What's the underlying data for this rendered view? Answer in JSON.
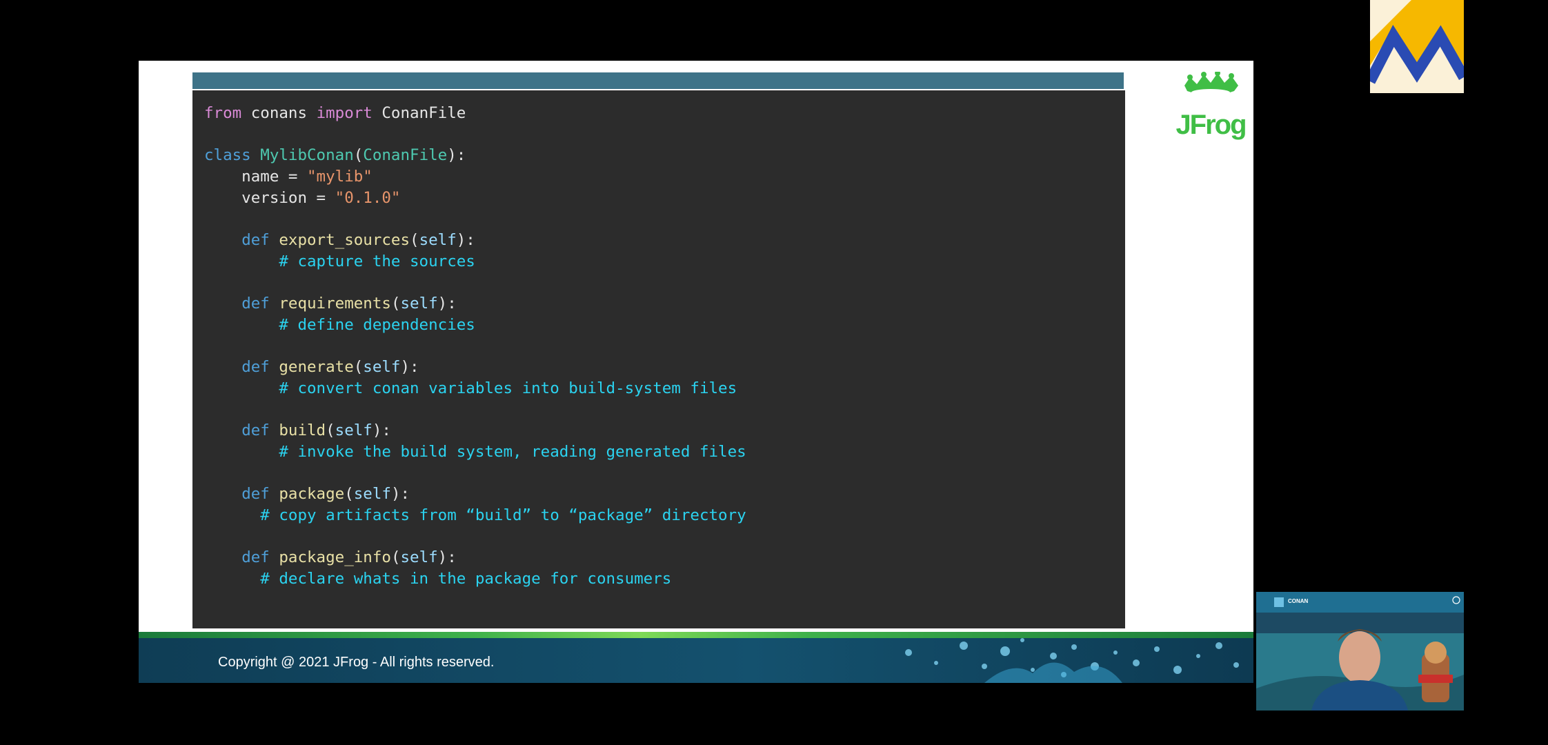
{
  "code": {
    "lines": [
      [
        {
          "t": "from",
          "c": "kw-pink"
        },
        {
          "t": " conans ",
          "c": ""
        },
        {
          "t": "import",
          "c": "kw-pink"
        },
        {
          "t": " ConanFile",
          "c": ""
        }
      ],
      [],
      [
        {
          "t": "class",
          "c": "kw-blue"
        },
        {
          "t": " ",
          "c": ""
        },
        {
          "t": "MylibConan",
          "c": "cls"
        },
        {
          "t": "(",
          "c": ""
        },
        {
          "t": "ConanFile",
          "c": "cls"
        },
        {
          "t": "):",
          "c": ""
        }
      ],
      [
        {
          "t": "    name = ",
          "c": ""
        },
        {
          "t": "\"mylib\"",
          "c": "str"
        }
      ],
      [
        {
          "t": "    version = ",
          "c": ""
        },
        {
          "t": "\"0.1.0\"",
          "c": "str"
        }
      ],
      [],
      [
        {
          "t": "    ",
          "c": ""
        },
        {
          "t": "def",
          "c": "kw-blue"
        },
        {
          "t": " ",
          "c": ""
        },
        {
          "t": "export_sources",
          "c": "fn"
        },
        {
          "t": "(",
          "c": ""
        },
        {
          "t": "self",
          "c": "self"
        },
        {
          "t": "):",
          "c": ""
        }
      ],
      [
        {
          "t": "        # capture the sources",
          "c": "cmt"
        }
      ],
      [],
      [
        {
          "t": "    ",
          "c": ""
        },
        {
          "t": "def",
          "c": "kw-blue"
        },
        {
          "t": " ",
          "c": ""
        },
        {
          "t": "requirements",
          "c": "fn"
        },
        {
          "t": "(",
          "c": ""
        },
        {
          "t": "self",
          "c": "self"
        },
        {
          "t": "):",
          "c": ""
        }
      ],
      [
        {
          "t": "        # define dependencies",
          "c": "cmt"
        }
      ],
      [],
      [
        {
          "t": "    ",
          "c": ""
        },
        {
          "t": "def",
          "c": "kw-blue"
        },
        {
          "t": " ",
          "c": ""
        },
        {
          "t": "generate",
          "c": "fn"
        },
        {
          "t": "(",
          "c": ""
        },
        {
          "t": "self",
          "c": "self"
        },
        {
          "t": "):",
          "c": ""
        }
      ],
      [
        {
          "t": "        # convert conan variables into build-system files",
          "c": "cmt"
        }
      ],
      [],
      [
        {
          "t": "    ",
          "c": ""
        },
        {
          "t": "def",
          "c": "kw-blue"
        },
        {
          "t": " ",
          "c": ""
        },
        {
          "t": "build",
          "c": "fn"
        },
        {
          "t": "(",
          "c": ""
        },
        {
          "t": "self",
          "c": "self"
        },
        {
          "t": "):",
          "c": ""
        }
      ],
      [
        {
          "t": "        # invoke the build system, reading generated files",
          "c": "cmt"
        }
      ],
      [],
      [
        {
          "t": "    ",
          "c": ""
        },
        {
          "t": "def",
          "c": "kw-blue"
        },
        {
          "t": " ",
          "c": ""
        },
        {
          "t": "package",
          "c": "fn"
        },
        {
          "t": "(",
          "c": ""
        },
        {
          "t": "self",
          "c": "self"
        },
        {
          "t": "):",
          "c": ""
        }
      ],
      [
        {
          "t": "      # copy artifacts from “build” to “package” directory",
          "c": "cmt"
        }
      ],
      [],
      [
        {
          "t": "    ",
          "c": ""
        },
        {
          "t": "def",
          "c": "kw-blue"
        },
        {
          "t": " ",
          "c": ""
        },
        {
          "t": "package_info",
          "c": "fn"
        },
        {
          "t": "(",
          "c": ""
        },
        {
          "t": "self",
          "c": "self"
        },
        {
          "t": "):",
          "c": ""
        }
      ],
      [
        {
          "t": "      # declare whats in the package for consumers",
          "c": "cmt"
        }
      ]
    ]
  },
  "logo": {
    "text": "JFrog",
    "color": "#40be46"
  },
  "footer": {
    "copyright": "Copyright @ 2021 JFrog - All rights reserved."
  },
  "webcam": {
    "brand": "CONAN"
  },
  "colors": {
    "header_bar": "#3e7388",
    "code_bg": "#2c2c2c",
    "comment": "#2bd3f0",
    "accent_green": "#40be46",
    "corner_yellow": "#f6b800",
    "corner_blue": "#2a4bb3"
  }
}
